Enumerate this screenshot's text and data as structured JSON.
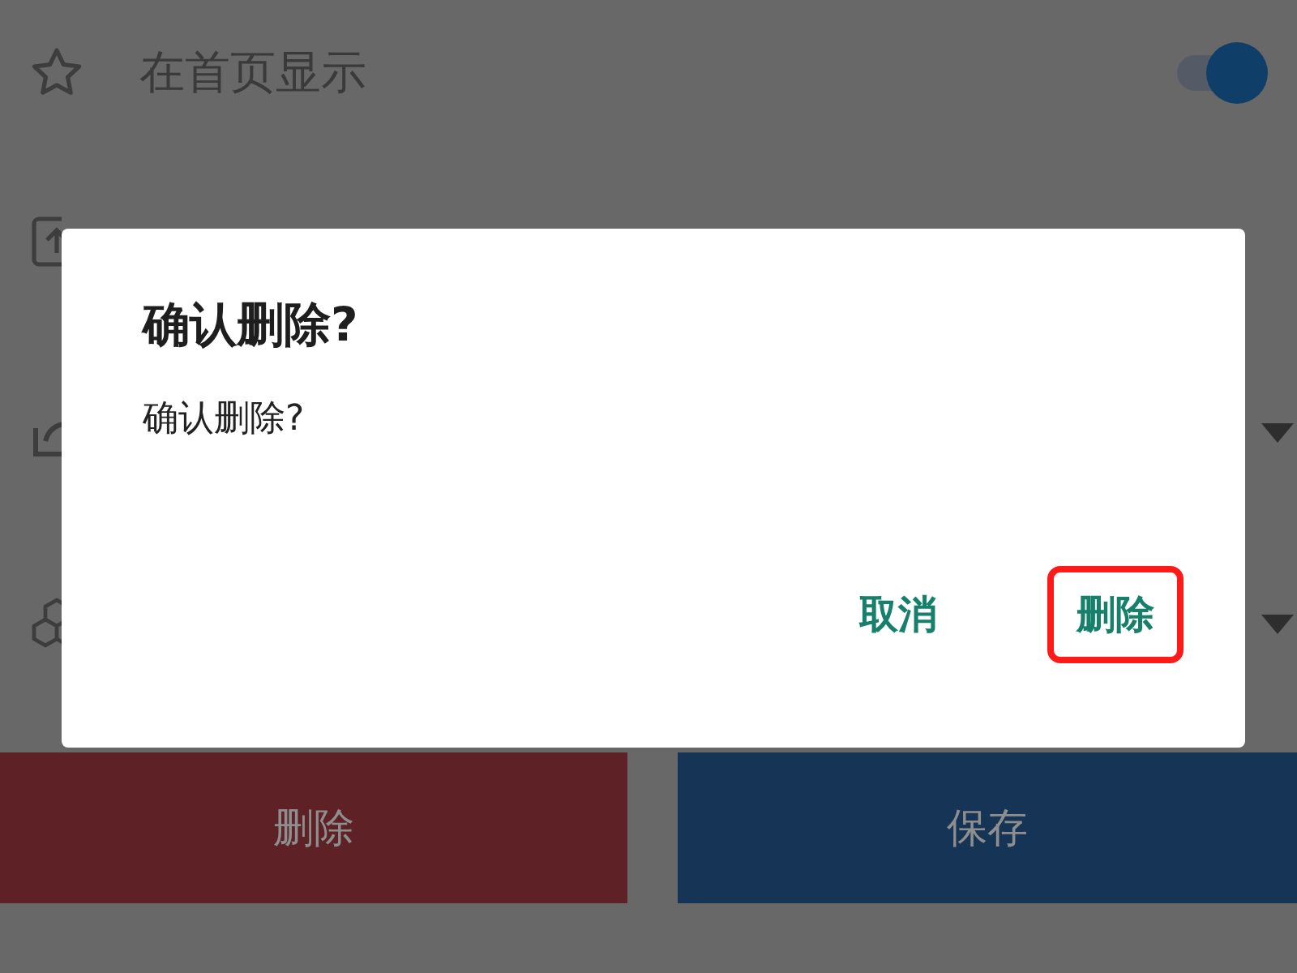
{
  "settings": [
    {
      "kind": "toggle",
      "label": "在首页显示",
      "on": true
    },
    {
      "kind": "plain"
    },
    {
      "kind": "dropdown"
    },
    {
      "kind": "dropdown"
    }
  ],
  "buttons": [
    {
      "label": "删除",
      "kind": "danger"
    },
    {
      "label": "保存",
      "kind": "primary"
    }
  ],
  "dialog": {
    "title": "确认删除?",
    "message": "确认删除?",
    "actions": [
      {
        "label": "取消",
        "highlighted": false
      },
      {
        "label": "删除",
        "highlighted": true
      }
    ]
  }
}
